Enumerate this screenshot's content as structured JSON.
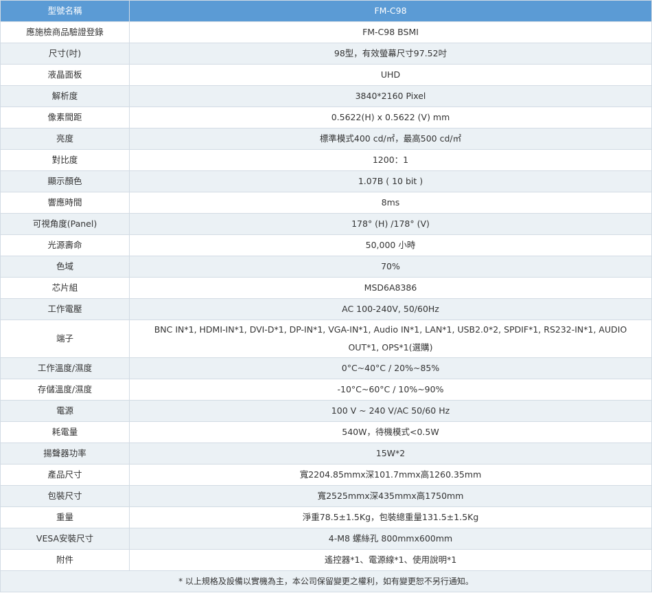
{
  "header": {
    "label": "型號名稱",
    "value": "FM-C98"
  },
  "rows": [
    {
      "label": "應施檢商品驗證登錄",
      "value": "FM-C98 BSMI"
    },
    {
      "label": "尺寸(吋)",
      "value": "98型，有效螢幕尺寸97.52吋"
    },
    {
      "label": "液晶面板",
      "value": "UHD"
    },
    {
      "label": "解析度",
      "value": "3840*2160 Pixel"
    },
    {
      "label": "像素間距",
      "value": "0.5622(H) x 0.5622 (V) mm"
    },
    {
      "label": "亮度",
      "value": "標準模式400 cd/㎡，最高500 cd/㎡"
    },
    {
      "label": "對比度",
      "value": "1200：1"
    },
    {
      "label": "顯示顏色",
      "value": "1.07B ( 10 bit )"
    },
    {
      "label": "響應時間",
      "value": "8ms"
    },
    {
      "label": "可視角度(Panel)",
      "value": "178° (H) /178° (V)"
    },
    {
      "label": "光源壽命",
      "value": "50,000 小時"
    },
    {
      "label": "色域",
      "value": "70%"
    },
    {
      "label": "芯片組",
      "value": "MSD6A8386"
    },
    {
      "label": "工作電壓",
      "value": "AC 100-240V, 50/60Hz"
    },
    {
      "label": "端子",
      "value": "BNC IN*1, HDMI-IN*1, DVI-D*1, DP-IN*1, VGA-IN*1, Audio IN*1, LAN*1, USB2.0*2, SPDIF*1, RS232-IN*1, AUDIO OUT*1, OPS*1(選購)"
    },
    {
      "label": "工作溫度/濕度",
      "value": "0°C~40°C / 20%~85%"
    },
    {
      "label": "存儲溫度/濕度",
      "value": "-10°C~60°C / 10%~90%"
    },
    {
      "label": "電源",
      "value": "100 V ~ 240 V/AC 50/60 Hz"
    },
    {
      "label": "耗電量",
      "value": "540W，待機模式<0.5W"
    },
    {
      "label": "揚聲器功率",
      "value": "15W*2"
    },
    {
      "label": "產品尺寸",
      "value": "寬2204.85mmx深101.7mmx高1260.35mm"
    },
    {
      "label": "包裝尺寸",
      "value": "寬2525mmx深435mmx高1750mm"
    },
    {
      "label": "重量",
      "value": "淨重78.5±1.5Kg，包裝總重量131.5±1.5Kg"
    },
    {
      "label": "VESA安裝尺寸",
      "value": "4-M8 螺絲孔 800mmx600mm"
    },
    {
      "label": "附件",
      "value": "遙控器*1、電源線*1、使用說明*1"
    }
  ],
  "footer": {
    "note": "* 以上規格及設備以實機為主，本公司保留變更之權利，如有變更恕不另行通知。"
  }
}
